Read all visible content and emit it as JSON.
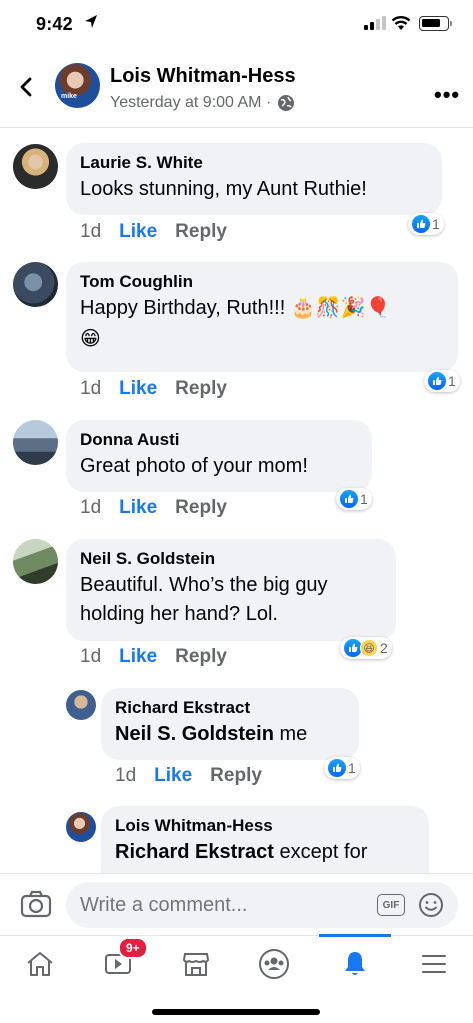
{
  "status_bar": {
    "time": "9:42"
  },
  "header": {
    "title": "Lois Whitman-Hess",
    "meta": "Yesterday at 9:00 AM ·",
    "avatar_text": "mike"
  },
  "comments": [
    {
      "name": "Laurie S. White",
      "text": "Looks stunning, my Aunt Ruthie!",
      "time": "1d",
      "like": "Like",
      "reply": "Reply",
      "reactions": "1"
    },
    {
      "name": "Tom Coughlin",
      "text": "Happy Birthday, Ruth!!!",
      "emoji": "🎂🎊🎉🎈",
      "emoji2": "😁",
      "time": "1d",
      "like": "Like",
      "reply": "Reply",
      "reactions": "1"
    },
    {
      "name": "Donna Austi",
      "text": "Great photo of your mom!",
      "time": "1d",
      "like": "Like",
      "reply": "Reply",
      "reactions": "1"
    },
    {
      "name": "Neil S. Goldstein",
      "text": "Beautiful. Who’s the big guy holding her hand? Lol.",
      "time": "1d",
      "like": "Like",
      "reply": "Reply",
      "reactions": "2"
    },
    {
      "name": "Richard Ekstract",
      "tag": "Neil S. Goldstein",
      "text": " me",
      "time": "1d",
      "like": "Like",
      "reply": "Reply",
      "reactions": "1"
    },
    {
      "name": "Lois Whitman-Hess",
      "tag": "Richard Ekstract",
      "text": " except for"
    }
  ],
  "compose": {
    "placeholder": "Write a comment...",
    "gif": "GIF"
  },
  "tabbar": {
    "video_badge": "9+"
  },
  "colors": {
    "accent": "#1877f2",
    "bubble": "#f0f2f5",
    "badge": "#e41e3f"
  }
}
